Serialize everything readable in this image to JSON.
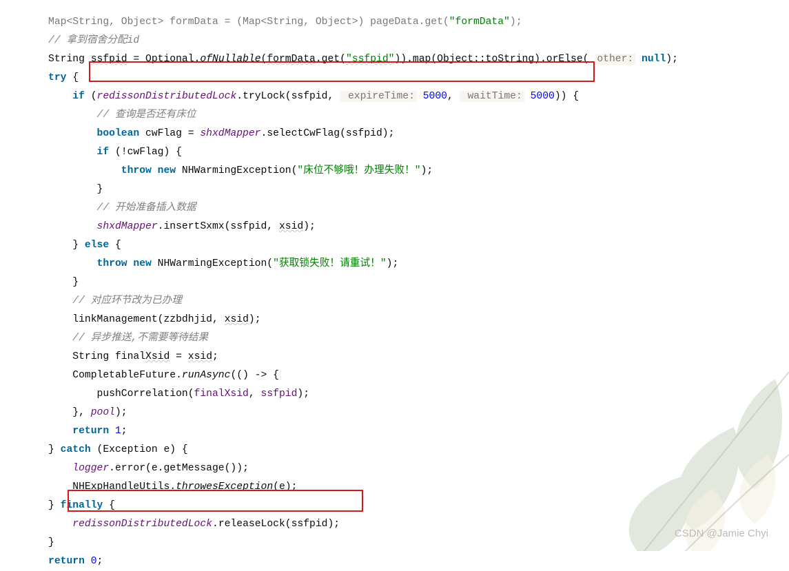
{
  "code": {
    "l0a": "Map<String, Object> formData = (Map<String, Object>) pageData.get(",
    "l0b": "\"formData\"",
    "l0c": ");",
    "l1": "// 拿到宿舍分配id",
    "l2a": "String ",
    "l2b": "ssfpid",
    "l2c": " = Optional.",
    "l2d": "ofNullable",
    "l2e": "(",
    "l2f": "formData",
    "l2g": ".get(",
    "l2h": "\"ssfpid\"",
    "l2i": ")).map(Object::toString).orElse( ",
    "l2hint": "other:",
    "l2j": " null",
    "l2k": ");",
    "l3a": "try",
    "l3b": " {",
    "l4a": "if",
    "l4b": " (",
    "l4c": "redissonDistributedLock",
    "l4d": ".tryLock(ssfpid, ",
    "l4h1": " expireTime:",
    "l4v1": " 5000",
    "l4s": ", ",
    "l4h2": " waitTime:",
    "l4v2": " 5000",
    "l4e": ")) {",
    "l5": "// 查询是否还有床位",
    "l6a": "boolean",
    "l6b": " cwFlag = ",
    "l6c": "shxdMapper",
    "l6d": ".selectCwFlag(ssfpid);",
    "l7a": "if",
    "l7b": " (!cwFlag) {",
    "l8a": "throw new",
    "l8b": " NHWarmingException(",
    "l8c": "\"床位不够哦！办理失败！\"",
    "l8d": ");",
    "l9": "}",
    "l10": "// 开始准备插入数据",
    "l11a": "shxdMapper",
    "l11b": ".insertSxmx(ssfpid, ",
    "l11c": "xsid",
    "l11d": ");",
    "l12a": "} ",
    "l12b": "else",
    "l12c": " {",
    "l13a": "throw new",
    "l13b": " NHWarmingException(",
    "l13c": "\"获取锁失败！请重试！\"",
    "l13d": ");",
    "l14": "}",
    "l15": "// 对应环节改为已办理",
    "l16a": "linkManagement(zzbdhjid, ",
    "l16b": "xsid",
    "l16c": ");",
    "l17": "// 异步推送,不需要等待结果",
    "l18a": "String final",
    "l18b": "Xsid",
    "l18c": " = ",
    "l18d": "xsid",
    "l18e": ";",
    "l19a": "CompletableFuture.",
    "l19b": "runAsync",
    "l19c": "(() -> {",
    "l20a": "pushCorrelation(",
    "l20b": "finalXsid",
    "l20c": ", ",
    "l20d": "ssfpid",
    "l20e": ");",
    "l21a": "}, ",
    "l21b": "pool",
    "l21c": ");",
    "l22a": "return ",
    "l22b": "1",
    "l22c": ";",
    "l23a": "} ",
    "l23b": "catch",
    "l23c": " (Exception e) {",
    "l24a": "logger",
    "l24b": ".error(e.getMessage());",
    "l25a": "NHExpHandleUtils.",
    "l25b": "throwesException",
    "l25c": "(e);",
    "l26a": "} ",
    "l26b": "finally",
    "l26c": " {",
    "l27a": "redissonDistributedLock",
    "l27b": ".releaseLock(ssfpid);",
    "l28": "}",
    "l29a": "return ",
    "l29b": "0",
    "l29c": ";"
  },
  "watermark": "CSDN @Jamie Chyi"
}
